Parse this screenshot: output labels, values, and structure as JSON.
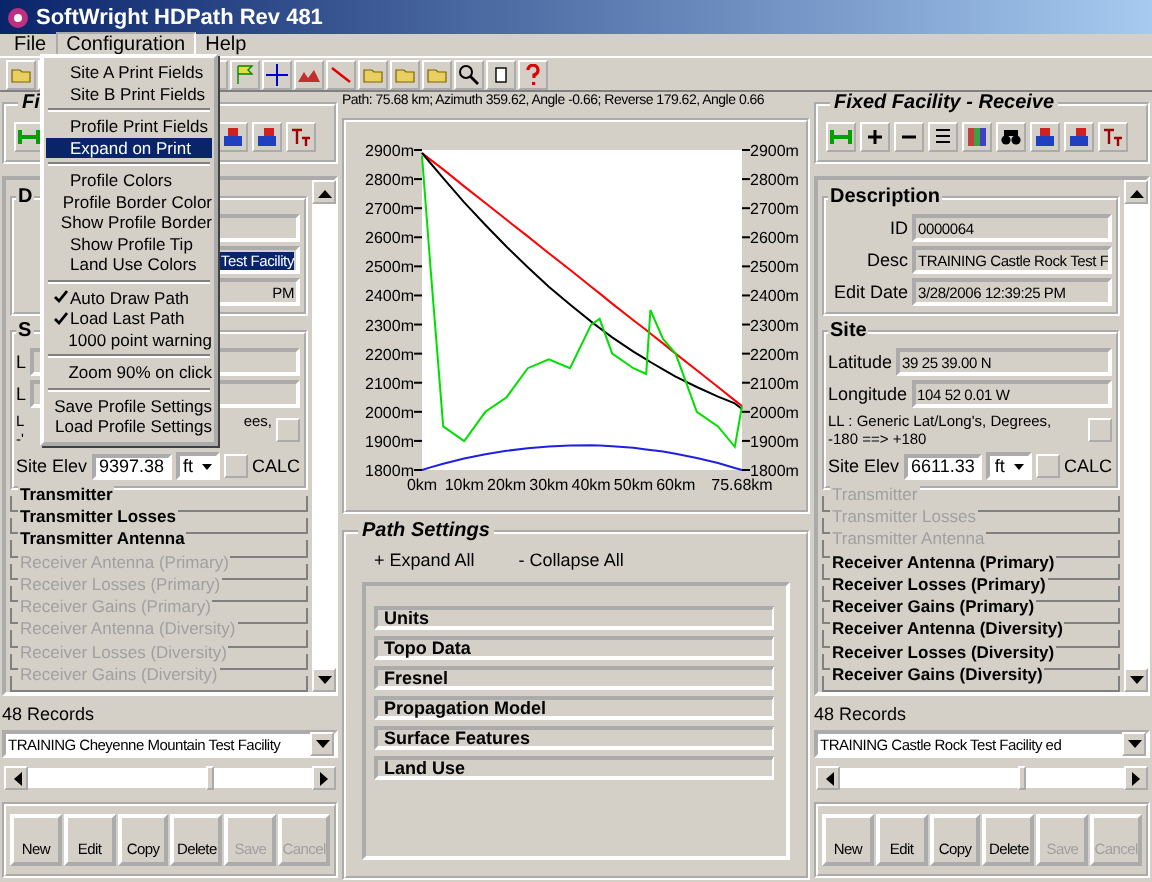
{
  "window": {
    "title": "SoftWright HDPath Rev 481"
  },
  "menu_bar": [
    {
      "label": "File",
      "selected": false
    },
    {
      "label": "Configuration",
      "selected": true
    },
    {
      "label": "Help",
      "selected": false
    }
  ],
  "open_menu": [
    {
      "kind": "item",
      "label": "Site A Print Fields",
      "checked": false,
      "selected": false
    },
    {
      "kind": "item",
      "label": "Site B Print Fields",
      "checked": false,
      "selected": false
    },
    {
      "kind": "separator"
    },
    {
      "kind": "item",
      "label": "Profile Print Fields",
      "checked": false,
      "selected": false
    },
    {
      "kind": "item",
      "label": "Expand on Print",
      "checked": false,
      "selected": true
    },
    {
      "kind": "separator"
    },
    {
      "kind": "item",
      "label": "Profile Colors",
      "checked": false,
      "selected": false
    },
    {
      "kind": "item",
      "label": "Profile Border Color",
      "checked": false,
      "selected": false
    },
    {
      "kind": "item",
      "label": "Show Profile Border",
      "checked": false,
      "selected": false
    },
    {
      "kind": "item",
      "label": "Show Profile Tip",
      "checked": false,
      "selected": false
    },
    {
      "kind": "item",
      "label": "Land Use Colors",
      "checked": false,
      "selected": false
    },
    {
      "kind": "separator"
    },
    {
      "kind": "item",
      "label": "Auto Draw Path",
      "checked": true,
      "selected": false
    },
    {
      "kind": "item",
      "label": "Load Last Path",
      "checked": true,
      "selected": false
    },
    {
      "kind": "item",
      "label": "1000 point warning",
      "checked": false,
      "selected": false
    },
    {
      "kind": "separator"
    },
    {
      "kind": "item",
      "label": "Zoom 90% on click",
      "checked": false,
      "selected": false
    },
    {
      "kind": "separator"
    },
    {
      "kind": "item",
      "label": "Save Profile Settings",
      "checked": false,
      "selected": false
    },
    {
      "kind": "item",
      "label": "Load Profile Settings",
      "checked": false,
      "selected": false
    }
  ],
  "panels": [
    {
      "title": "Fi",
      "description": {
        "title": "D",
        "fields": [
          {
            "selected": false
          },
          {
            "value": "Test Facility",
            "selected": true
          },
          {
            "value": "PM",
            "selected": false
          }
        ]
      },
      "site": {
        "title": "S",
        "fields": [
          {
            "label": "L"
          },
          {
            "label": "L"
          }
        ],
        "note": [
          [
            "L",
            "ees,"
          ],
          [
            "-'"
          ]
        ],
        "elevation": {
          "label": "Site Elev",
          "value": "9397.38",
          "unit": "ft",
          "calc": "CALC"
        }
      },
      "sections": [
        {
          "label": "Transmitter",
          "enabled": true
        },
        {
          "label": "Transmitter Losses",
          "enabled": true
        },
        {
          "label": "Transmitter Antenna",
          "enabled": true
        },
        {
          "label": "Receiver Antenna (Primary)",
          "enabled": false
        },
        {
          "label": "Receiver Losses (Primary)",
          "enabled": false
        },
        {
          "label": "Receiver Gains (Primary)",
          "enabled": false
        },
        {
          "label": "Receiver Antenna (Diversity)",
          "enabled": false
        },
        {
          "label": "Receiver Losses (Diversity)",
          "enabled": false
        },
        {
          "label": "Receiver Gains (Diversity)",
          "enabled": false
        }
      ],
      "records": "48 Records",
      "combo": "TRAINING Cheyenne Mountain Test Facility",
      "buttons": [
        {
          "label": "New",
          "disabled": false
        },
        {
          "label": "Edit",
          "disabled": false
        },
        {
          "label": "Copy",
          "disabled": false
        },
        {
          "label": "Delete",
          "disabled": false
        },
        {
          "label": "Save",
          "disabled": true
        },
        {
          "label": "Cancel",
          "disabled": true
        }
      ]
    },
    {
      "title": "Fixed Facility - Receive",
      "description": {
        "title": "Description",
        "fields": [
          {
            "label": "ID",
            "value": "0000064",
            "selected": false
          },
          {
            "label": "Desc",
            "value": "TRAINING Castle Rock Test F",
            "selected": false
          },
          {
            "label": "Edit Date",
            "value": "3/28/2006 12:39:25 PM",
            "selected": false
          }
        ]
      },
      "site": {
        "title": "Site",
        "fields": [
          {
            "label": "Latitude",
            "value": "39 25 39.00 N"
          },
          {
            "label": "Longitude",
            "value": "104 52 0.01 W"
          }
        ],
        "note": [
          [
            "LL : Generic Lat/Long's, Degrees,"
          ],
          [
            "-180 ==> +180"
          ]
        ],
        "elevation": {
          "label": "Site Elev",
          "value": "6611.33",
          "unit": "ft",
          "calc": "CALC"
        }
      },
      "sections": [
        {
          "label": "Transmitter",
          "enabled": false
        },
        {
          "label": "Transmitter Losses",
          "enabled": false
        },
        {
          "label": "Transmitter Antenna",
          "enabled": false
        },
        {
          "label": "Receiver Antenna (Primary)",
          "enabled": true
        },
        {
          "label": "Receiver Losses (Primary)",
          "enabled": true
        },
        {
          "label": "Receiver Gains (Primary)",
          "enabled": true
        },
        {
          "label": "Receiver Antenna (Diversity)",
          "enabled": true
        },
        {
          "label": "Receiver Losses (Diversity)",
          "enabled": true
        },
        {
          "label": "Receiver Gains (Diversity)",
          "enabled": true
        }
      ],
      "records": "48 Records",
      "combo": "TRAINING Castle Rock Test Facility ed",
      "buttons": [
        {
          "label": "New",
          "disabled": false
        },
        {
          "label": "Edit",
          "disabled": false
        },
        {
          "label": "Copy",
          "disabled": false
        },
        {
          "label": "Delete",
          "disabled": false
        },
        {
          "label": "Save",
          "disabled": true
        },
        {
          "label": "Cancel",
          "disabled": true
        }
      ]
    }
  ],
  "path_info": "Path: 75.68 km; Azimuth 359.62, Angle -0.66; Reverse 179.62, Angle 0.66",
  "profile": {
    "chart_data": {
      "type": "line",
      "x": [
        0,
        2,
        5,
        10,
        15,
        20,
        25,
        30,
        35,
        40,
        42,
        45,
        50,
        53,
        54,
        57,
        60,
        65,
        70,
        74,
        75.68
      ],
      "series": [
        {
          "color": "#ff0000",
          "values": [
            2890,
            2867,
            2833,
            2775,
            2718,
            2660,
            2603,
            2545,
            2488,
            2430,
            2407,
            2372,
            2315,
            2281,
            2269,
            2235,
            2200,
            2143,
            2085,
            2039,
            2020
          ]
        },
        {
          "color": "#000000",
          "values": [
            2890,
            2855,
            2803,
            2720,
            2642,
            2567,
            2497,
            2430,
            2369,
            2310,
            2288,
            2256,
            2207,
            2180,
            2171,
            2146,
            2121,
            2085,
            2052,
            2029,
            2010
          ]
        },
        {
          "color": "#00e000",
          "values": [
            2880,
            2500,
            1950,
            1900,
            2000,
            2050,
            2150,
            2180,
            2150,
            2300,
            2320,
            2200,
            2150,
            2130,
            2350,
            2250,
            2200,
            2000,
            1950,
            1880,
            2020
          ]
        },
        {
          "color": "#2020e0",
          "values": [
            1800,
            1809,
            1821,
            1839,
            1854,
            1866,
            1875,
            1881,
            1884,
            1885,
            1884,
            1882,
            1876,
            1871,
            1869,
            1863,
            1856,
            1841,
            1824,
            1807,
            1800
          ]
        }
      ],
      "xlim": [
        0,
        75.68
      ],
      "ylim": [
        1800,
        2900
      ],
      "xticks": [
        {
          "value": 0,
          "label": "0km"
        },
        {
          "value": 10,
          "label": "10km"
        },
        {
          "value": 20,
          "label": "20km"
        },
        {
          "value": 30,
          "label": "30km"
        },
        {
          "value": 40,
          "label": "40km"
        },
        {
          "value": 50,
          "label": "50km"
        },
        {
          "value": 60,
          "label": "60km"
        },
        {
          "value": 75.68,
          "label": "75.68km"
        }
      ],
      "yticks": [
        {
          "value": 1800,
          "label": "1800m"
        },
        {
          "value": 1900,
          "label": "1900m"
        },
        {
          "value": 2000,
          "label": "2000m"
        },
        {
          "value": 2100,
          "label": "2100m"
        },
        {
          "value": 2200,
          "label": "2200m"
        },
        {
          "value": 2300,
          "label": "2300m"
        },
        {
          "value": 2400,
          "label": "2400m"
        },
        {
          "value": 2500,
          "label": "2500m"
        },
        {
          "value": 2600,
          "label": "2600m"
        },
        {
          "value": 2700,
          "label": "2700m"
        },
        {
          "value": 2800,
          "label": "2800m"
        },
        {
          "value": 2900,
          "label": "2900m"
        }
      ]
    }
  },
  "path_settings": {
    "title": "Path Settings",
    "expand_all": "+ Expand All",
    "collapse_all": "- Collapse All",
    "sections": [
      "Units",
      "Topo Data",
      "Fresnel",
      "Propagation Model",
      "Surface Features",
      "Land Use"
    ]
  }
}
